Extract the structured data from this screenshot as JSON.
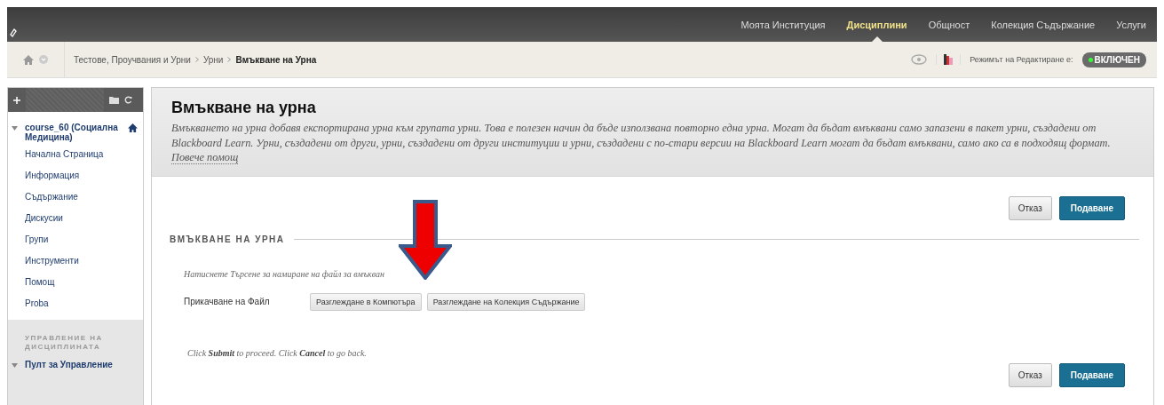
{
  "top_nav": {
    "items": [
      {
        "label": "Моята Институция",
        "selected": false
      },
      {
        "label": "Дисциплини",
        "selected": true
      },
      {
        "label": "Общност",
        "selected": false
      },
      {
        "label": "Колекция Съдържание",
        "selected": false
      },
      {
        "label": "Услуги",
        "selected": false
      }
    ]
  },
  "breadcrumbs": [
    {
      "label": "Тестове, Проучвания и Урни",
      "current": false
    },
    {
      "label": "Урни",
      "current": false
    },
    {
      "label": "Вмъкване на Урна",
      "current": true
    }
  ],
  "edit_mode": {
    "label": "Режимът на Редактиране е:",
    "value": "ВКЛЮЧЕН",
    "on": true
  },
  "sidebar": {
    "course": {
      "title": "course_60 (Социална Медицина)",
      "expanded": true
    },
    "items": [
      "Начална Страница",
      "Информация",
      "Съдържание",
      "Дискусии",
      "Групи",
      "Инструменти",
      "Помощ",
      "Proba"
    ],
    "section_title": "УПРАВЛЕНИЕ НА ДИСЦИПЛИНАТА",
    "panel": {
      "label": "Пулт за Управление",
      "expanded": true
    }
  },
  "page": {
    "title": "Вмъкване на урна",
    "description": "Вмъкването на урна добавя експортирана урна към групата урни. Това е полезен начин да бъде използвана повторно една урна. Могат да бъдат вмъквани само запазени в пакет урни, създадени от Blackboard Learn. Урни, създадени от други, урни, създадени от други институции и урни, създадени с по-стари версии на Blackboard Learn могат да бъдат вмъквани, само ако са в подходящ формат.",
    "help_link": "Повече помощ",
    "top_buttons": [
      {
        "label": "Отказ",
        "kind": "secondary"
      },
      {
        "label": "Подаване",
        "kind": "primary"
      }
    ],
    "section_title": "ВМЪКВАНЕ НА УРНА",
    "instruction": "Натиснете Търсене за намиране на файл за вмъкван",
    "field": {
      "label": "Прикачване на Файл",
      "buttons": [
        "Разглеждане в Компютъра",
        "Разглеждане на Колекция Съдържание"
      ]
    },
    "footer_note": "Click **Submit** to proceed. Click **Cancel** to go back.",
    "bottom_buttons": [
      {
        "label": "Отказ",
        "kind": "secondary"
      },
      {
        "label": "Подаване",
        "kind": "primary"
      }
    ]
  }
}
